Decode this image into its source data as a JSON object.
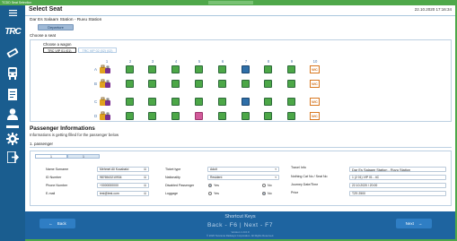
{
  "window": {
    "title": "TCDD Seat Selection",
    "date": "22.10.2020 17:16:34"
  },
  "page": {
    "title": "Select Seat",
    "route": "Dar Es Salaam Station - Ruvu Station",
    "direction_tab": "Departure",
    "choose_seat_label": "Choose a seat"
  },
  "seat_map": {
    "choose_wagon_label": "Choose a wagon",
    "wagons": [
      {
        "label": "TRC VIP 01 (01)",
        "active": true
      },
      {
        "label": "TRC VIP 02 (02) (02)",
        "active": false
      }
    ],
    "columns": [
      "1",
      "2",
      "3",
      "4",
      "5",
      "6",
      "7",
      "8",
      "9",
      "10"
    ],
    "rows": [
      "A",
      "B",
      "C",
      "D"
    ],
    "wc_label": "WC",
    "seat_states": {
      "A": [
        "lug",
        "free",
        "free",
        "free",
        "free",
        "free",
        "occupied",
        "free",
        "free",
        "wc"
      ],
      "B": [
        "lug",
        "free",
        "free",
        "free",
        "free",
        "free",
        "free",
        "free",
        "free",
        "wc"
      ],
      "C": [
        "lug",
        "free",
        "free",
        "free",
        "free",
        "free",
        "occupied",
        "free",
        "free",
        "wc"
      ],
      "D": [
        "lug",
        "free",
        "free",
        "free",
        "reserved",
        "free",
        "free",
        "free",
        "free",
        "wc"
      ]
    },
    "colors": {
      "free": "#4ca747",
      "occupied": "#2f6fa8",
      "reserved": "#d25a9a",
      "wc": "#d97820"
    }
  },
  "passenger": {
    "title": "Passenger Informations",
    "subtitle": "Informations is getting filled for the passenger below",
    "passenger_label": "1. passenger",
    "tabs": [
      "1",
      "1"
    ],
    "labels": {
      "name": "Name Surname",
      "id": "ID Number",
      "phone": "Phone Number",
      "email": "E-mail",
      "ticket_type": "Ticket type",
      "nationality": "Nationality",
      "disabled": "Disabled Passenger",
      "luggage": "Luggage",
      "travel_info": "Travel Info",
      "nothing_to": "Nothing Cat No / Seat No",
      "journey_date": "Journey Date/Time",
      "price": "Price"
    },
    "values": {
      "name": "Mehmet Ali Kocabalci",
      "id": "9876543210934",
      "phone": "+0000000000",
      "email": "test@test.com",
      "ticket_type": "Adult",
      "nationality": "Resident",
      "travel_info": "Dar Es Salaam Station - Ruvu Station",
      "seat_no": "1 (2 01) VIP 01 - 4C",
      "journey_date": "22.10.2020 / 20:00",
      "price": "TZS 2500"
    },
    "radio": {
      "yes": "Yes",
      "no": "No"
    }
  },
  "nav": {
    "back_label": "Back",
    "next_label": "Next",
    "shortcut_title": "Shortcut Keys",
    "shortcut_keys": "Back - F6 | Next - F7",
    "version": "Version 1.0.0.0",
    "copyright": "© 2020 Tanzania Railways Corporation. All Rights Reserved."
  }
}
